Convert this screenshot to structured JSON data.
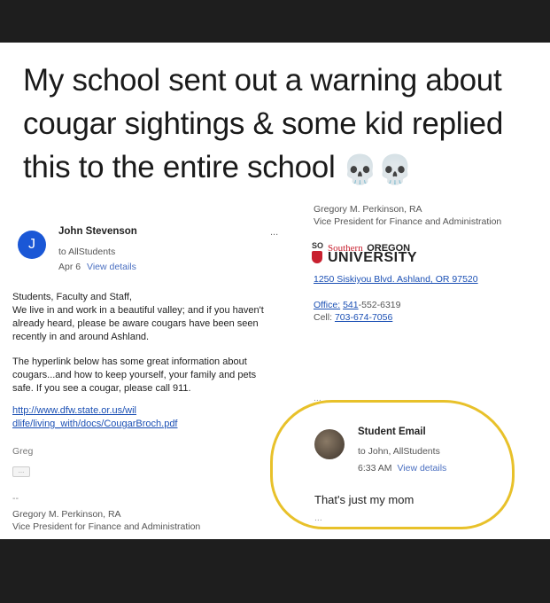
{
  "caption": "My school sent out a warning about cougar sightings & some kid replied this to the entire school",
  "caption_emoji": "💀💀",
  "left_email": {
    "avatar_letter": "J",
    "sender": "John Stevenson",
    "to": "to AllStudents",
    "date": "Apr 6",
    "view_details": "View details",
    "more": "...",
    "para1": "Students, Faculty and Staff,\nWe live in and work in a beautiful valley; and if you haven't already heard, please be aware cougars have been seen recently in and around Ashland.",
    "para2": "The hyperlink below has some great information about cougars...and how to keep yourself, your family and pets safe.  If you see a cougar, please call 911.",
    "link_line1": "http://www.dfw.state.or.us/wil",
    "link_line2": "dlife/living_with/docs/CougarBroch.pdf",
    "signoff": "Greg",
    "dots": "...",
    "sig_dash": "--",
    "sig_name": "Gregory M. Perkinson, RA",
    "sig_title": "Vice President for Finance and Administration"
  },
  "right_sig": {
    "name": "Gregory M. Perkinson, RA",
    "title": "Vice President for Finance and Administration",
    "logo_so": "SO",
    "logo_southern": "Southern",
    "logo_oregon": "OREGON",
    "logo_university": "UNIVERSITY",
    "address": "1250 Siskiyou Blvd. Ashland, OR 97520",
    "office_label": "Office:",
    "office_link": "541",
    "office_rest": "-552-6319",
    "cell_label": "Cell:",
    "cell_link": "703-674-7056",
    "dots": "..."
  },
  "reply": {
    "sender": "Student Email",
    "to": "to John, AllStudents",
    "time": "6:33 AM",
    "view_details": "View details",
    "message": "That's just my mom",
    "dots": "..."
  },
  "colors": {
    "highlight": "#e8c12a",
    "avatar": "#1a57d6",
    "link": "#1a4fb4",
    "logo_red": "#c8202f"
  }
}
